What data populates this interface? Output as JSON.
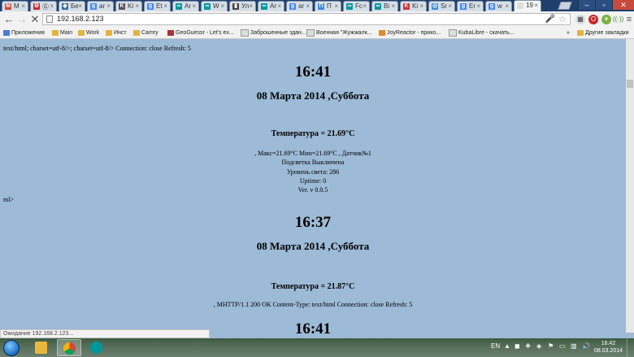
{
  "browser": {
    "tabs": [
      {
        "label": "M",
        "fav_color": "#d44638",
        "fav": "M"
      },
      {
        "label": "Ⓖ",
        "fav_color": "#c62828",
        "fav": "⚙"
      },
      {
        "label": "Бе",
        "fav_color": "#3a6ea5",
        "fav": "◆"
      },
      {
        "label": "ar",
        "fav_color": "#4285f4",
        "fav": "g"
      },
      {
        "label": "Ki",
        "fav_color": "#555555",
        "fav": "K"
      },
      {
        "label": "Et",
        "fav_color": "#4285f4",
        "fav": "g"
      },
      {
        "label": "Ar",
        "fav_color": "#00979c",
        "fav": "∞"
      },
      {
        "label": "W",
        "fav_color": "#00979c",
        "fav": "∞"
      },
      {
        "label": "Ул",
        "fav_color": "#444444",
        "fav": "▮"
      },
      {
        "label": "Ar",
        "fav_color": "#00979c",
        "fav": "∞"
      },
      {
        "label": "ar",
        "fav_color": "#4285f4",
        "fav": "g"
      },
      {
        "label": "П",
        "fav_color": "#3a8dde",
        "fav": "П"
      },
      {
        "label": "Fc",
        "fav_color": "#00979c",
        "fav": "∞"
      },
      {
        "label": "Bi",
        "fav_color": "#00979c",
        "fav": "∞"
      },
      {
        "label": "Ki",
        "fav_color": "#d32f2f",
        "fav": "K"
      },
      {
        "label": "Sr",
        "fav_color": "#3a8dde",
        "fav": "◎"
      },
      {
        "label": "Er",
        "fav_color": "#4285f4",
        "fav": "g"
      },
      {
        "label": "w",
        "fav_color": "#4285f4",
        "fav": "g"
      },
      {
        "label": "19",
        "fav_color": "#dddddd",
        "fav": "",
        "active": true
      }
    ],
    "url": "192.168.2.123",
    "bookmarks": [
      {
        "label": "Приложения",
        "icon": "apps-icon"
      },
      {
        "label": "Main",
        "icon": "folder-icon"
      },
      {
        "label": "Work",
        "icon": "folder-icon"
      },
      {
        "label": "Инст",
        "icon": "folder-icon"
      },
      {
        "label": "Camry",
        "icon": "folder-icon"
      },
      {
        "label": "GeoGuessr - Let's ex...",
        "icon": "geoguessr-icon"
      },
      {
        "label": "Заброшенные здан...",
        "icon": "page-icon"
      },
      {
        "label": "Военная \"Жужжалк...",
        "icon": "page-icon"
      },
      {
        "label": "JoyReactor - прико...",
        "icon": "joyreactor-icon"
      },
      {
        "label": "KubaLibre - скачать...",
        "icon": "page-icon"
      }
    ],
    "bookmarks_more": "»",
    "other_bookmarks": "Другие закладки",
    "status_text": "Ожидание 192.168.2.123..."
  },
  "page": {
    "header_raw": "text/html; charset=utf-8/>; charset=utf-8/> Connection: close Refresh: 5",
    "block1": {
      "time": "16:41",
      "date": "08 Марта 2014 ,Суббота",
      "temp": "Температура = 21.69°C",
      "minmax": ", Макс=21.69°C Мин=21.69°C , Датчик№1",
      "backlight": "Подсветка Выключена",
      "light": "Уровень света: 286",
      "uptime": "Uptime: 0",
      "version": "Ver. v 0.0.5"
    },
    "separator_raw": "ml>",
    "block2": {
      "time": "16:37",
      "date": "08 Марта 2014 ,Суббота",
      "temp": "Температура = 21.87°C",
      "minmax": ", MHTTP/1.1 200 OK Content-Type: text/html Connection: close Refresh: 5"
    },
    "block3": {
      "time": "16:41"
    }
  },
  "taskbar": {
    "lang": "EN",
    "clock_time": "16:42",
    "clock_date": "08.03.2014"
  }
}
